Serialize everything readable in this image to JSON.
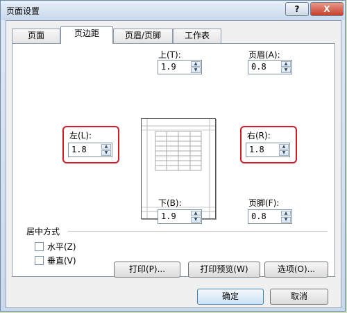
{
  "window": {
    "title": "页面设置"
  },
  "titlebar": {
    "help": "?",
    "close": "X"
  },
  "tabs": [
    "页面",
    "页边距",
    "页眉/页脚",
    "工作表"
  ],
  "margins": {
    "top": {
      "label": "上(T):",
      "value": "1.9"
    },
    "header": {
      "label": "页眉(A):",
      "value": "0.8"
    },
    "left": {
      "label": "左(L):",
      "value": "1.8"
    },
    "right": {
      "label": "右(R):",
      "value": "1.8"
    },
    "bottom": {
      "label": "下(B):",
      "value": "1.9"
    },
    "footer": {
      "label": "页脚(F):",
      "value": "0.8"
    }
  },
  "centering": {
    "title": "居中方式",
    "horizontal": "水平(Z)",
    "vertical": "垂直(V)"
  },
  "buttons": {
    "print": "打印(P)...",
    "preview": "打印预览(W)",
    "options": "选项(O)...",
    "ok": "确定",
    "cancel": "取消"
  },
  "highlight_color": "#d61a2a"
}
